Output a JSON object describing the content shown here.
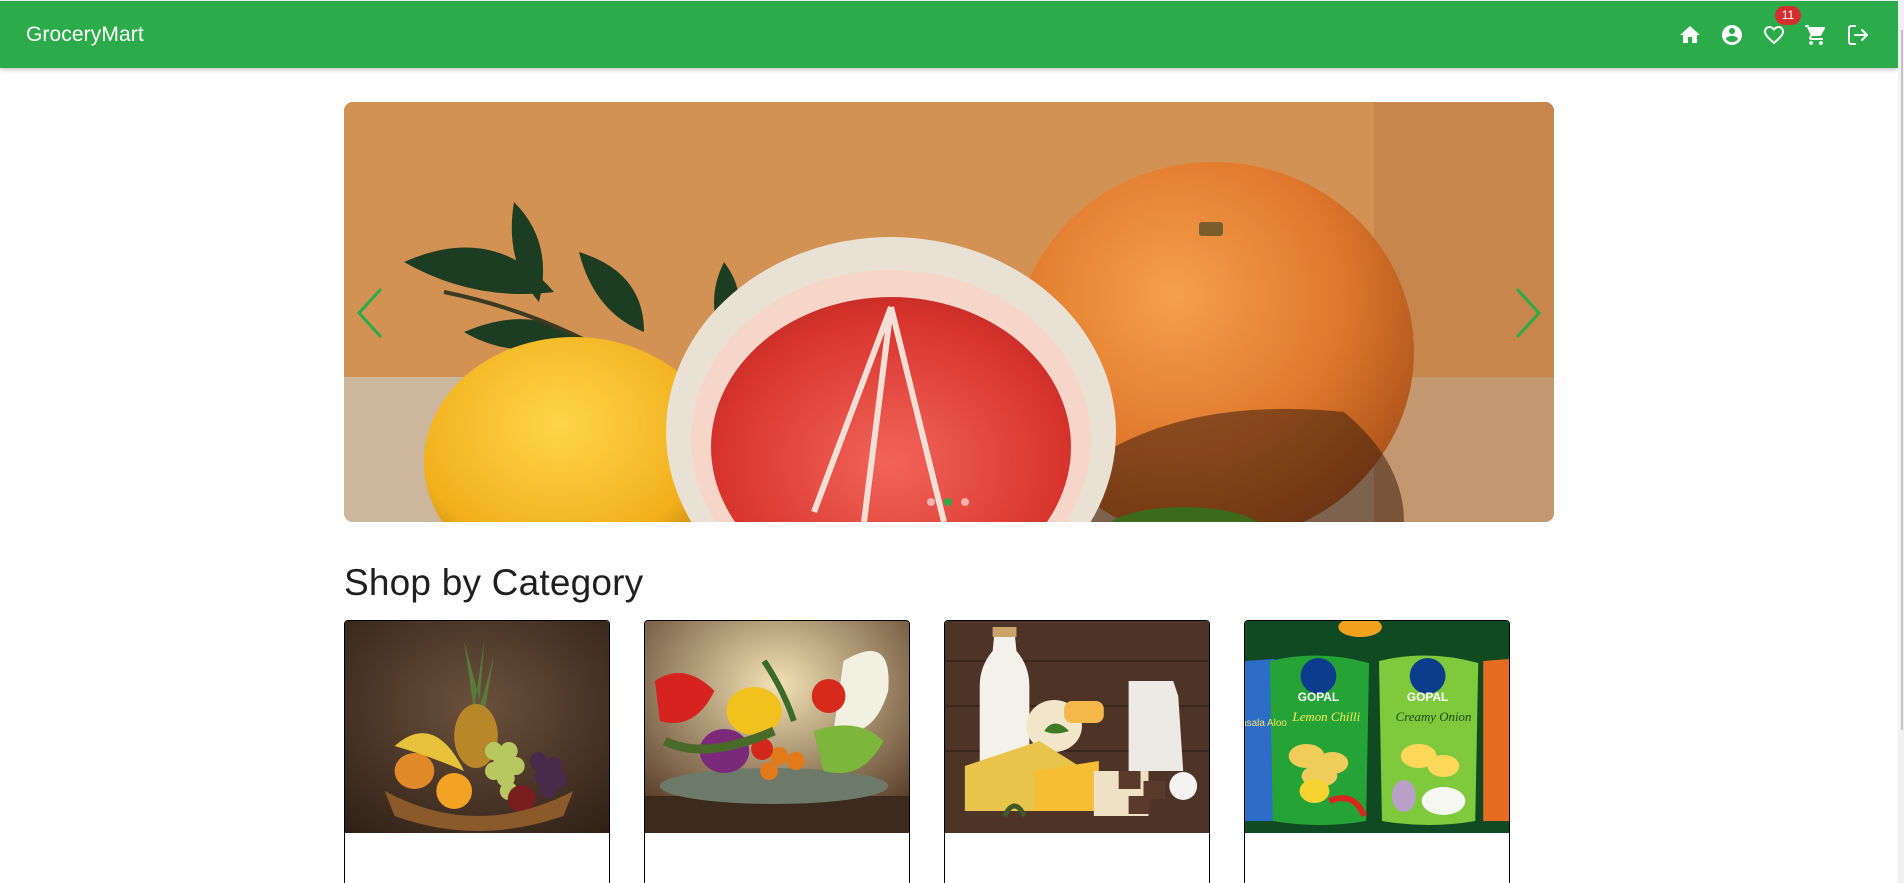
{
  "header": {
    "brand": "GroceryMart",
    "icons": [
      "home-icon",
      "account-icon",
      "favorite-icon",
      "cart-icon",
      "logout-icon"
    ],
    "favorites_count": "11"
  },
  "carousel": {
    "slides_count": 3,
    "active_index": 1,
    "accent": "#2bab49"
  },
  "categories": {
    "title": "Shop by Category",
    "items": [
      {
        "icon": "fruit-basket-image"
      },
      {
        "icon": "vegetable-platter-image"
      },
      {
        "icon": "dairy-products-image"
      },
      {
        "icon": "snack-packets-image",
        "image_text": [
          "GOPAL",
          "GOPAL",
          "Masala Aloo",
          "Lemon Chilli",
          "Creamy Onion"
        ]
      }
    ]
  },
  "colors": {
    "primary": "#2bab49",
    "badge": "#d32f2f"
  }
}
